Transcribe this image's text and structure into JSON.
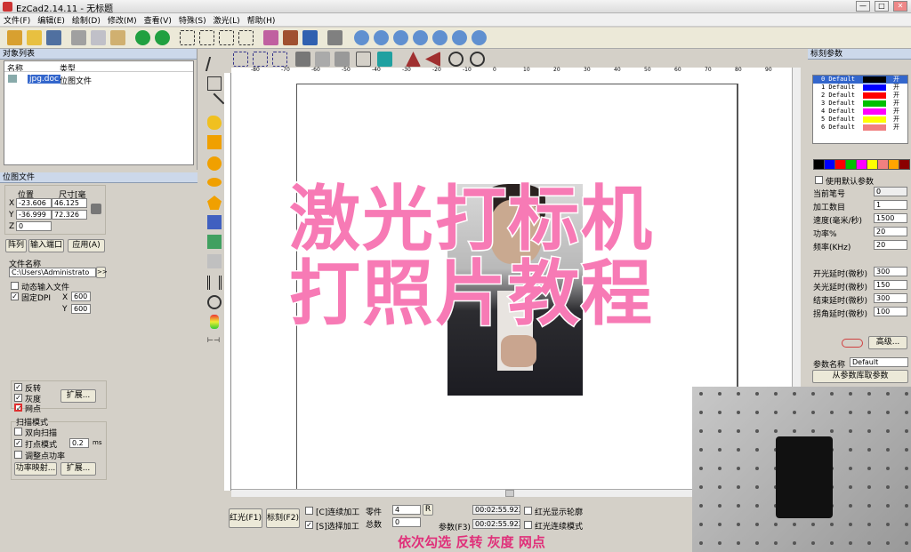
{
  "window": {
    "title": "EzCad2.14.11 - 无标题",
    "min": "—",
    "max": "□",
    "close": "✕"
  },
  "menu": [
    "文件(F)",
    "编辑(E)",
    "绘制(D)",
    "修改(M)",
    "查看(V)",
    "特殊(S)",
    "激光(L)",
    "帮助(H)"
  ],
  "obj_list": {
    "title": "对象列表",
    "col_name": "名称",
    "col_type": "类型",
    "row_name": "jpg.doc",
    "row_type": "位图文件"
  },
  "bitmap_panel": {
    "title": "位图文件",
    "pos_label": "位置",
    "size_label": "尺寸[毫",
    "x_label": "X",
    "y_label": "Y",
    "z_label": "Z",
    "x_pos": "-23.606",
    "x_size": "46.125",
    "y_pos": "-36.999",
    "y_size": "72.326",
    "z_pos": "0",
    "array_btn": "阵列",
    "input_btn": "输入端口",
    "apply_btn": "应用(A)",
    "file_label": "文件名称",
    "file_path": "C:\\Users\\Administrato",
    "dynamic_input": "动态输入文件",
    "fixed_dpi": "固定DPI",
    "dpi_x_label": "X",
    "dpi_x": "600",
    "dpi_y_label": "Y",
    "dpi_y": "600",
    "invert": "反转",
    "gray": "灰度",
    "dither": "网点",
    "expand1": "扩展...",
    "scan_mode": "扫描模式",
    "bidir": "双向扫描",
    "dot_mode": "打点模式",
    "dot_val": "0.2",
    "dot_unit": "ms",
    "adjust_power": "调整点功率",
    "power_map": "功率映射...",
    "expand2": "扩展..."
  },
  "pens": {
    "title": "标刻参数",
    "col_pen": "笔号",
    "col_color": "颜色",
    "col_on": "开/",
    "items": [
      {
        "label": "0 Default",
        "color": "#000000",
        "on": "开"
      },
      {
        "label": "1 Default",
        "color": "#0000ff",
        "on": "开"
      },
      {
        "label": "2 Default",
        "color": "#ff0000",
        "on": "开"
      },
      {
        "label": "3 Default",
        "color": "#00c000",
        "on": "开"
      },
      {
        "label": "4 Default",
        "color": "#ff00ff",
        "on": "开"
      },
      {
        "label": "5 Default",
        "color": "#ffff00",
        "on": "开"
      },
      {
        "label": "6 Default",
        "color": "#f08080",
        "on": "开"
      }
    ],
    "palette": [
      "#000000",
      "#0000ff",
      "#ff0000",
      "#00c000",
      "#ff00ff",
      "#ffff00",
      "#f08080",
      "#ffa500",
      "#8b0000"
    ]
  },
  "mark_params": {
    "use_default": "使用默认参数",
    "cur_pen_label": "当前笔号",
    "cur_pen": "0",
    "count_label": "加工数目",
    "count": "1",
    "speed_label": "速度(毫米/秒)",
    "speed": "1500",
    "power_label": "功率%",
    "power": "20",
    "freq_label": "频率(KHz)",
    "freq": "20",
    "on_delay_label": "开光延时(微秒)",
    "on_delay": "300",
    "off_delay_label": "关光延时(微秒)",
    "off_delay": "150",
    "end_delay_label": "结束延时(微秒)",
    "end_delay": "300",
    "corner_delay_label": "拐角延时(微秒)",
    "corner_delay": "100",
    "advanced": "高级...",
    "param_name_label": "参数名称",
    "param_name": "Default",
    "lib_btn": "从参数库取参数"
  },
  "ruler": {
    "top": [
      "-80",
      "-70",
      "-60",
      "-50",
      "-40",
      "-30",
      "-20",
      "-10",
      "0",
      "10",
      "20",
      "30",
      "40",
      "50",
      "60",
      "70",
      "80",
      "90"
    ]
  },
  "bottom": {
    "red_btn": "红光(F1)",
    "mark_btn": "标刻(F2)",
    "continuous": "[C]连续加工",
    "selected": "[S]选择加工",
    "parts_label": "零件",
    "parts": "4",
    "total_label": "总数",
    "total": "0",
    "reset": "R",
    "param_btn": "参数(F3)",
    "time1": "00:02:55.923",
    "time2": "00:02:55.923",
    "red_contour": "红光显示轮廓",
    "red_continuous": "红光连续模式"
  },
  "overlay": {
    "line1": "激光打标机",
    "line2": "打照片教程"
  },
  "caption": "依次勾选 反转 灰度 网点"
}
